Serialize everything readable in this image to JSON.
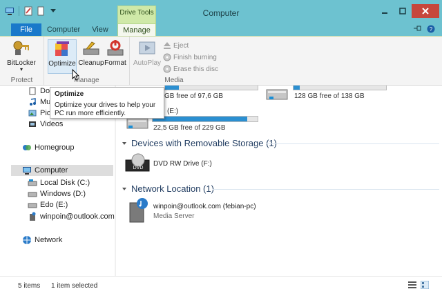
{
  "window": {
    "title": "Computer",
    "context_tab_header": "Drive Tools"
  },
  "tabs": {
    "file": "File",
    "computer": "Computer",
    "view": "View",
    "manage": "Manage"
  },
  "ribbon": {
    "bitlocker": "BitLocker",
    "optimize": "Optimize",
    "cleanup": "Cleanup",
    "format": "Format",
    "autoplay": "AutoPlay",
    "eject": "Eject",
    "finish_burning": "Finish burning",
    "erase_disc": "Erase this disc",
    "group_protect": "Protect",
    "group_manage": "Manage",
    "group_media": "Media"
  },
  "tooltip": {
    "title": "Optimize",
    "text": "Optimize your drives to help your PC run more efficiently."
  },
  "nav": {
    "lib_documents_partial": "Do",
    "lib_music_partial": "Mu",
    "lib_pictures_partial": "Pic",
    "videos": "Videos",
    "homegroup": "Homegroup",
    "computer": "Computer",
    "local_disk": "Local Disk (C:)",
    "windows_d": "Windows (D:)",
    "edo_e": "Edo (E:)",
    "winpoin": "winpoin@outlook.com (f",
    "network": "Network"
  },
  "content": {
    "drive_d_free": "GB free of 97,6 GB",
    "drive_d_usage": 0.15,
    "drive_right_free": "128 GB free of 138 GB",
    "drive_right_usage": 0.07,
    "drive_e_label_partial": "(E:)",
    "drive_e_free": "22,5 GB free of 229 GB",
    "drive_e_usage": 0.9,
    "removable_header": "Devices with Removable Storage (1)",
    "dvd_name": "DVD RW Drive (F:)",
    "network_header": "Network Location (1)",
    "media_server_name": "winpoin@outlook.com (febian-pc)",
    "media_server_type": "Media Server"
  },
  "status": {
    "items": "5 items",
    "selected": "1 item selected"
  },
  "colors": {
    "titlebar": "#6dc2d0",
    "file_tab": "#1979ca",
    "context": "#cfe9a8",
    "close": "#c7473c",
    "progress": "#2b8fd1"
  }
}
